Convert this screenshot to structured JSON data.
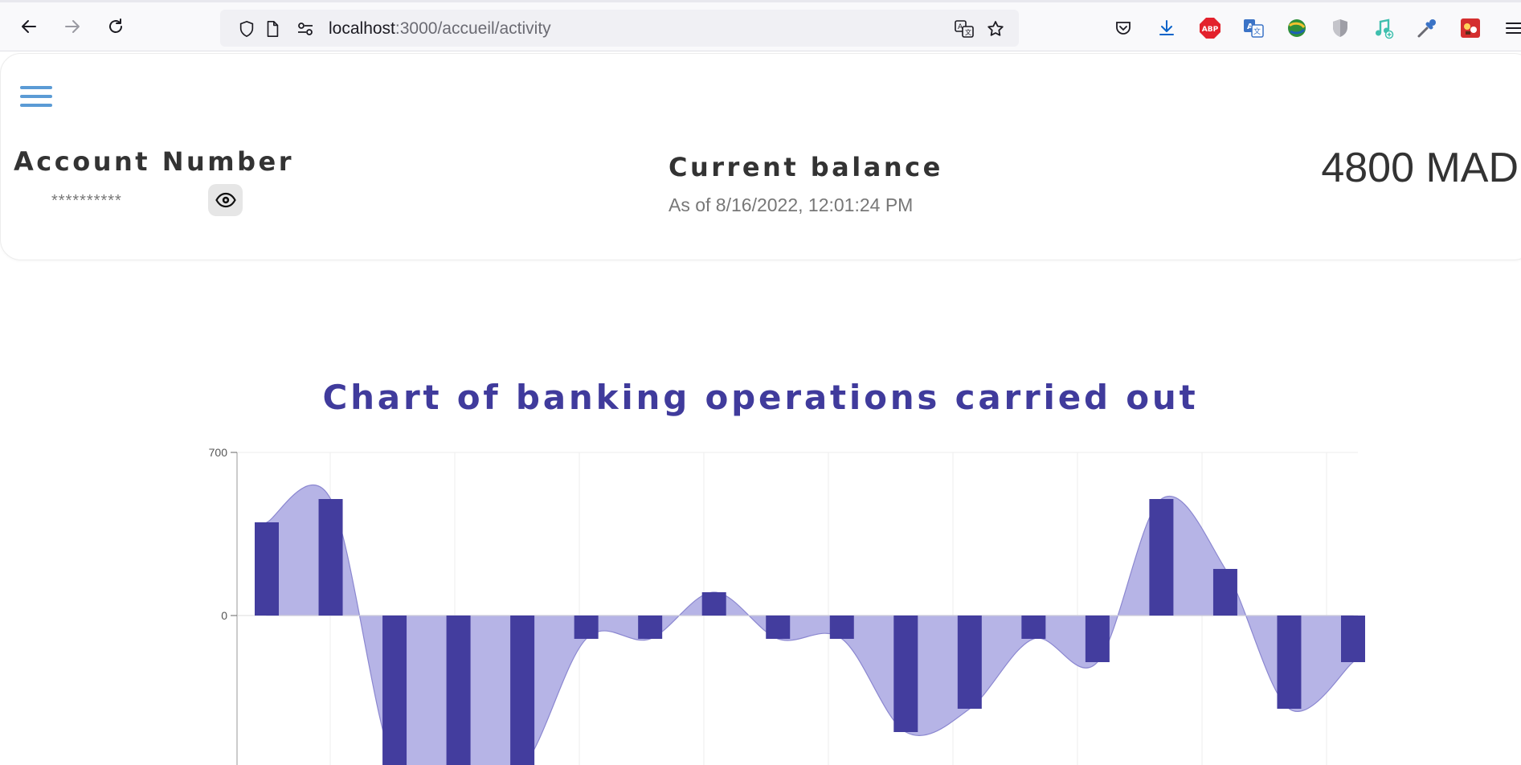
{
  "browser": {
    "url_host": "localhost",
    "url_path": ":3000/accueil/activity",
    "nav_icons": [
      "back-arrow-icon",
      "forward-arrow-icon",
      "reload-icon"
    ],
    "url_icons": [
      "shield-icon",
      "page-icon",
      "site-permissions-icon"
    ],
    "toolbar_icons": [
      "translate-icon",
      "bookmark-star-icon",
      "pocket-icon",
      "download-icon",
      "adblock-icon",
      "translate-extension-icon",
      "download-manager-icon",
      "privacy-shield-icon",
      "music-extension-icon",
      "color-picker-icon",
      "game-extension-icon",
      "menu-icon"
    ],
    "adblock_label": "ABP"
  },
  "account": {
    "label": "Account Number",
    "masked_number": "**********",
    "reveal_icon": "eye-icon"
  },
  "balance": {
    "title": "Current balance",
    "as_of": "As of 8/16/2022, 12:01:24 PM",
    "amount": "4800 MAD"
  },
  "colors": {
    "accent": "#403b9c",
    "bar": "#433d9e",
    "area_fill": "#b6b4e6",
    "area_stroke": "#8b87d0",
    "hamburger": "#5b9bd5"
  },
  "chart_data": {
    "type": "bar",
    "title": "Chart of banking operations carried out",
    "xlabel": "",
    "ylabel": "",
    "y_ticks": [
      "0",
      "700"
    ],
    "ylim": [
      -650,
      700
    ],
    "grid": true,
    "values": [
      400,
      500,
      -650,
      -650,
      -650,
      -100,
      -100,
      100,
      -100,
      -100,
      -500,
      -400,
      -100,
      -200,
      500,
      200,
      -400,
      -200
    ],
    "overlay": "area"
  }
}
